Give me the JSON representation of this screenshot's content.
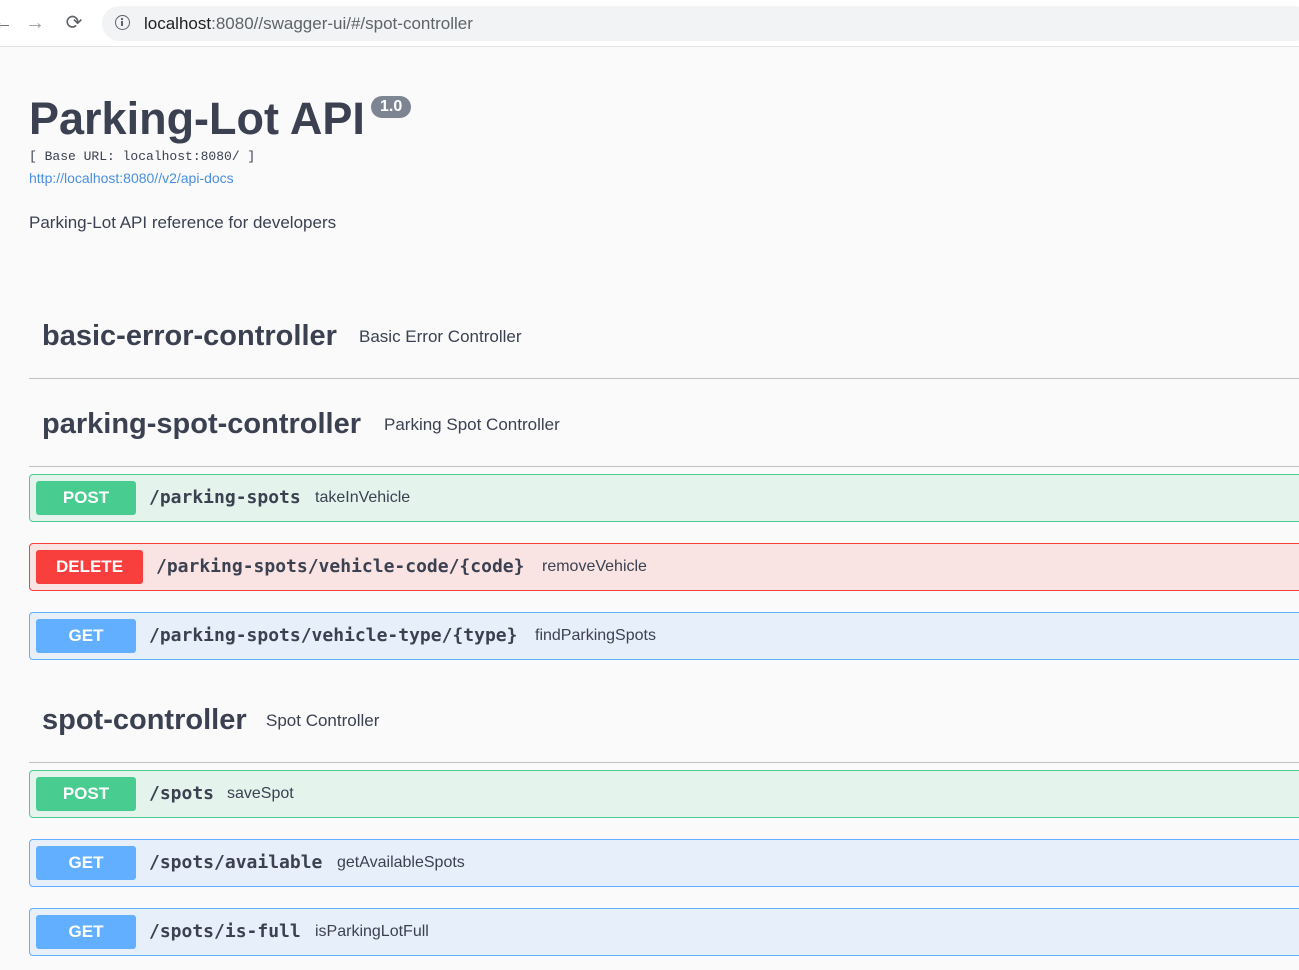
{
  "browser": {
    "url_host": "localhost",
    "url_rest": ":8080//swagger-ui/#/spot-controller",
    "back_icon": "arrow-left",
    "forward_icon": "arrow-right",
    "reload_icon": "reload"
  },
  "info": {
    "title": "Parking-Lot API",
    "version": "1.0",
    "base_url": "[ Base URL: localhost:8080/ ]",
    "api_docs_link": "http://localhost:8080//v2/api-docs",
    "description": "Parking-Lot API reference for developers"
  },
  "tags": [
    {
      "name": "basic-error-controller",
      "description": "Basic Error Controller",
      "operations": []
    },
    {
      "name": "parking-spot-controller",
      "description": "Parking Spot Controller",
      "operations": [
        {
          "method": "POST",
          "path": "/parking-spots",
          "summary": "takeInVehicle"
        },
        {
          "method": "DELETE",
          "path": "/parking-spots/vehicle-code/{code}",
          "summary": "removeVehicle"
        },
        {
          "method": "GET",
          "path": "/parking-spots/vehicle-type/{type}",
          "summary": "findParkingSpots"
        }
      ]
    },
    {
      "name": "spot-controller",
      "description": "Spot Controller",
      "operations": [
        {
          "method": "POST",
          "path": "/spots",
          "summary": "saveSpot"
        },
        {
          "method": "GET",
          "path": "/spots/available",
          "summary": "getAvailableSpots"
        },
        {
          "method": "GET",
          "path": "/spots/is-full",
          "summary": "isParkingLotFull"
        }
      ]
    }
  ],
  "colors": {
    "post": "#49cc90",
    "delete": "#f93e3e",
    "get": "#61affe",
    "text": "#3b4151",
    "link": "#4990e2"
  }
}
